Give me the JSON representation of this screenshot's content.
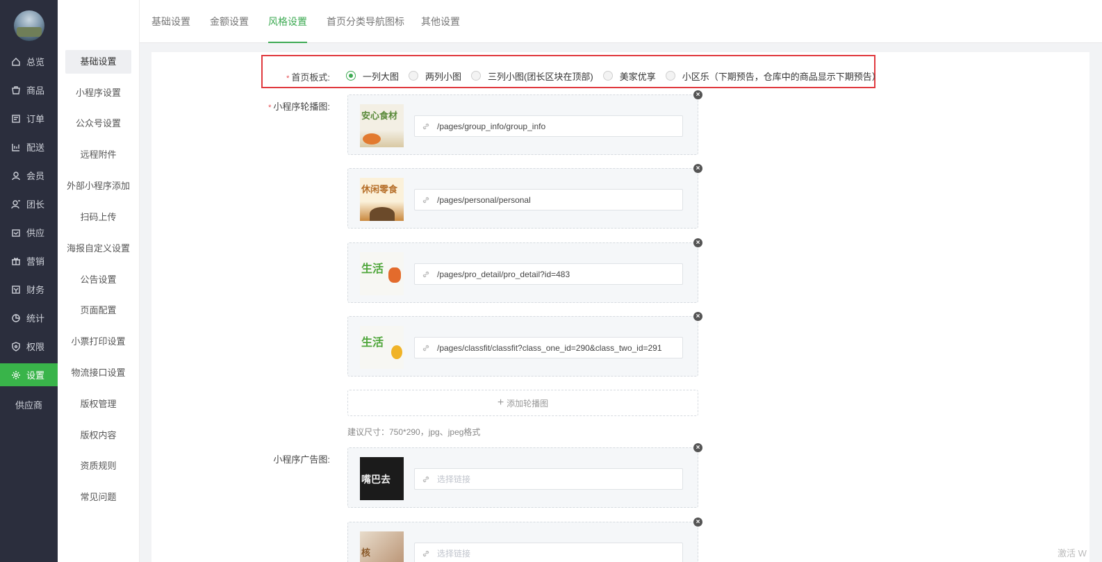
{
  "sidebar": {
    "items": [
      {
        "label": "总览",
        "icon": "home-icon"
      },
      {
        "label": "商品",
        "icon": "goods-icon"
      },
      {
        "label": "订单",
        "icon": "order-icon"
      },
      {
        "label": "配送",
        "icon": "delivery-icon"
      },
      {
        "label": "会员",
        "icon": "member-icon"
      },
      {
        "label": "团长",
        "icon": "leader-icon"
      },
      {
        "label": "供应",
        "icon": "supply-icon"
      },
      {
        "label": "营销",
        "icon": "gift-icon"
      },
      {
        "label": "财务",
        "icon": "finance-icon"
      },
      {
        "label": "统计",
        "icon": "stats-icon"
      },
      {
        "label": "权限",
        "icon": "shield-icon"
      },
      {
        "label": "设置",
        "icon": "gear-icon"
      }
    ],
    "extra": "供应商"
  },
  "subnav": {
    "items": [
      "基础设置",
      "小程序设置",
      "公众号设置",
      "远程附件",
      "外部小程序添加",
      "扫码上传",
      "海报自定义设置",
      "公告设置",
      "页面配置",
      "小票打印设置",
      "物流接口设置",
      "版权管理",
      "版权内容",
      "资质规则",
      "常见问题"
    ]
  },
  "tabs": [
    "基础设置",
    "金额设置",
    "风格设置",
    "首页分类导航图标",
    "其他设置"
  ],
  "form": {
    "layout": {
      "label": "首页板式:",
      "options": [
        "一列大图",
        "两列小图",
        "三列小图(团长区块在顶部)",
        "美家优享",
        "小区乐（下期预告，仓库中的商品显示下期预告）"
      ],
      "selected": "一列大图"
    },
    "carousel": {
      "label": "小程序轮播图:",
      "slides": [
        {
          "thumb_text": "安心食材",
          "link": "/pages/group_info/group_info"
        },
        {
          "thumb_text": "休闲零食",
          "link": "/pages/personal/personal"
        },
        {
          "thumb_text": "生活",
          "link": "/pages/pro_detail/pro_detail?id=483"
        },
        {
          "thumb_text": "生活",
          "link": "/pages/classfit/classfit?class_one_id=290&class_two_id=291"
        }
      ],
      "add_label": "添加轮播图",
      "hint": "建议尺寸：750*290，jpg、jpeg格式"
    },
    "ad": {
      "label": "小程序广告图:",
      "slides": [
        {
          "thumb_text": "嘴巴去",
          "placeholder": "选择链接"
        },
        {
          "thumb_text": "核",
          "placeholder": "选择链接"
        }
      ]
    }
  },
  "watermark": "激活 W",
  "colors": {
    "accent": "#3daa53",
    "sidebar_bg": "#2b2e3d",
    "highlight": "#e0393e"
  }
}
